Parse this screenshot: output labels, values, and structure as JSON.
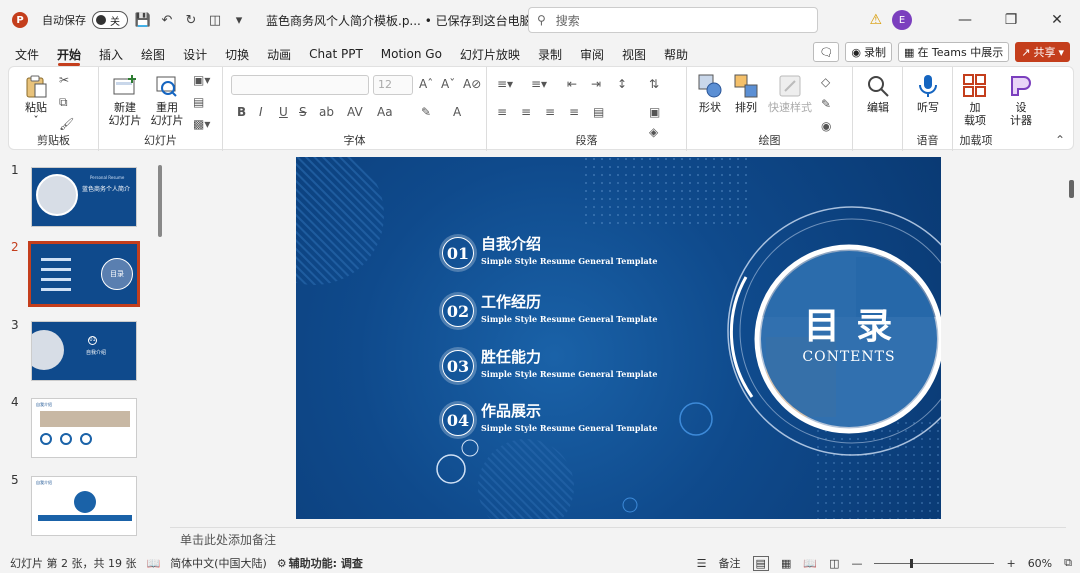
{
  "titlebar": {
    "autosave_label": "自动保存",
    "autosave_state": "关",
    "doc_title": "蓝色商务风个人简介模板.p... • 已保存到这台电脑",
    "search_placeholder": "搜索",
    "avatar_initial": "E"
  },
  "menu": {
    "tabs": [
      "文件",
      "开始",
      "插入",
      "绘图",
      "设计",
      "切换",
      "动画",
      "Chat PPT",
      "Motion Go",
      "幻灯片放映",
      "录制",
      "审阅",
      "视图",
      "帮助"
    ],
    "active_tab": "开始",
    "record_label": "录制",
    "teams_label": "在 Teams 中展示",
    "share_label": "共享"
  },
  "ribbon": {
    "clipboard": {
      "paste": "粘贴",
      "label": "剪贴板"
    },
    "slides": {
      "new_slide": "新建\n幻灯片",
      "reuse_slide": "重用\n幻灯片",
      "label": "幻灯片"
    },
    "font": {
      "size": "12",
      "label": "字体"
    },
    "paragraph": {
      "label": "段落"
    },
    "drawing": {
      "shape": "形状",
      "arrange": "排列",
      "quick_style": "快速样式",
      "label": "绘图"
    },
    "editing": {
      "label": "编辑"
    },
    "voice": {
      "dictate": "听写",
      "label": "语音"
    },
    "addins": {
      "addin": "加\n载项",
      "designer": "设\n计器",
      "label": "加载项"
    }
  },
  "thumbnails": [
    {
      "num": "1"
    },
    {
      "num": "2"
    },
    {
      "num": "3"
    },
    {
      "num": "4"
    },
    {
      "num": "5"
    }
  ],
  "thumb_text": {
    "t1_title": "蓝色商务个人简介",
    "t1_sub": "Personal Resume",
    "t2_title": "目录",
    "t3_title": "自我介绍",
    "t3_num": "01",
    "t4_title": "自我介绍",
    "t5_title": "自我介绍"
  },
  "slide": {
    "items": [
      {
        "num": "01",
        "title": "自我介绍",
        "subtitle": "Simple Style Resume General Template"
      },
      {
        "num": "02",
        "title": "工作经历",
        "subtitle": "Simple Style Resume General Template"
      },
      {
        "num": "03",
        "title": "胜任能力",
        "subtitle": "Simple Style Resume General Template"
      },
      {
        "num": "04",
        "title": "作品展示",
        "subtitle": "Simple Style Resume General Template"
      }
    ],
    "heading": "目 录",
    "heading_en": "CONTENTS"
  },
  "notes_placeholder": "单击此处添加备注",
  "status": {
    "slide_info": "幻灯片 第 2 张，共 19 张",
    "language": "简体中文(中国大陆)",
    "accessibility": "辅助功能: 调查",
    "notes": "备注",
    "zoom": "60%"
  },
  "colors": {
    "accent": "#c43e1c",
    "slide_bg": "#0f4a8c"
  }
}
